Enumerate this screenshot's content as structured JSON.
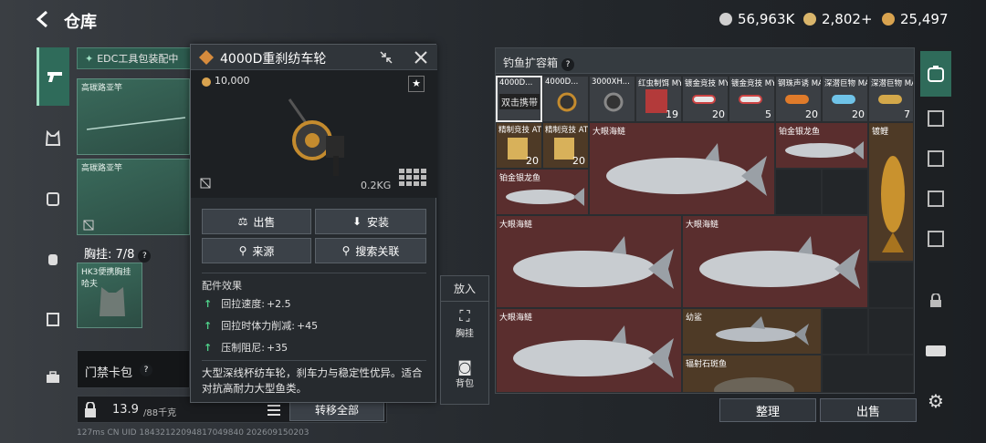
{
  "header": {
    "title": "仓库",
    "currencies": [
      {
        "value": "56,963K",
        "color": "#c8c8c8",
        "icon": "silver-coin-icon"
      },
      {
        "value": "2,802+",
        "color": "#d9b56b",
        "icon": "gold-coin-icon"
      },
      {
        "value": "25,497",
        "color": "#d9a34f",
        "icon": "bronze-coin-icon"
      }
    ]
  },
  "left": {
    "edc_label": "EDC工具包装配中",
    "slot1_label": "高碳路亚竿",
    "slot2_label": "高碳路亚竿",
    "chest_label": "胸挂: 7/8",
    "chest_help": "?",
    "chest_item": "HK3便携胸挂 哈夫",
    "keycard_label": "门禁卡包",
    "keycard_help": "?",
    "weight": "13.9",
    "weight_cap": "/88千克",
    "transfer_all": "转移全部",
    "footer_text": "127ms    CN UID 18432122094817049840 202609150203"
  },
  "popup": {
    "title": "4000D重刹纺车轮",
    "price": "10,000",
    "weight": "0.2KG",
    "buttons": {
      "sell": "出售",
      "install": "安装",
      "source": "来源",
      "search_related": "搜索关联"
    },
    "effects_title": "配件效果",
    "effects": [
      {
        "label": "回拉速度:",
        "value": "+2.5"
      },
      {
        "label": "回拉时体力削减:",
        "value": "+45"
      },
      {
        "label": "压制阻尼:",
        "value": "+35"
      }
    ],
    "description": "大型深线杯纺车轮，刹车力与稳定性优异。适合对抗高耐力大型鱼类。"
  },
  "putin": {
    "title": "放入",
    "chest": "胸挂",
    "backpack": "背包"
  },
  "container": {
    "title": "钓鱼扩容箱",
    "help": "?",
    "items_row1": [
      {
        "label": "4000D...",
        "sub": "双击携带",
        "count": ""
      },
      {
        "label": "4000D...",
        "count": ""
      },
      {
        "label": "3000XH...",
        "count": ""
      },
      {
        "label": "红虫制饵 MYT",
        "count": "19"
      },
      {
        "label": "镀金竞技 MYT",
        "count": "20"
      },
      {
        "label": "镀金竞技 MYT",
        "count": "5"
      },
      {
        "label": "钢珠声诱 MAS",
        "count": "20"
      },
      {
        "label": "深潜巨物 MAS",
        "count": "20"
      },
      {
        "label": "深潜巨物 MAS",
        "count": "7"
      }
    ],
    "items_row2": [
      {
        "label": "精制竞技 ATT",
        "count": "20"
      },
      {
        "label": "精制竞技 ATT",
        "count": "20"
      }
    ],
    "fish": {
      "tarpon1": "大眼海鲢",
      "silver_arowana1": "铂金银龙鱼",
      "golden_fish": "镀鲤",
      "silver_arowana2": "铂金银龙鱼",
      "tarpon2": "大眼海鲢",
      "tarpon3": "大眼海鲢",
      "tarpon4": "大眼海鲢",
      "shark": "幼鲨",
      "stingray": "辐射石斑鱼"
    },
    "sort_button": "整理",
    "sell_button": "出售"
  }
}
